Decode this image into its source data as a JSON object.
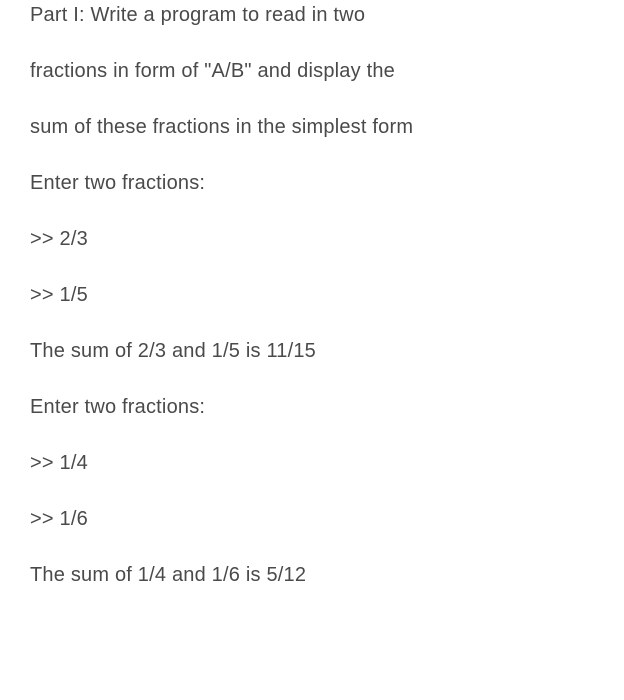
{
  "intro": {
    "line1": "Part I: Write a program to read in two",
    "line2": "fractions in form of \"A/B\" and display the",
    "line3": "sum of these fractions in the simplest form"
  },
  "example1": {
    "prompt": "Enter two fractions:",
    "input1": ">> 2/3",
    "input2": ">> 1/5",
    "result": "The sum of 2/3 and 1/5 is 11/15"
  },
  "example2": {
    "prompt": "Enter two fractions:",
    "input1": ">> 1/4",
    "input2": ">> 1/6",
    "result": "The sum of 1/4 and 1/6 is 5/12"
  }
}
